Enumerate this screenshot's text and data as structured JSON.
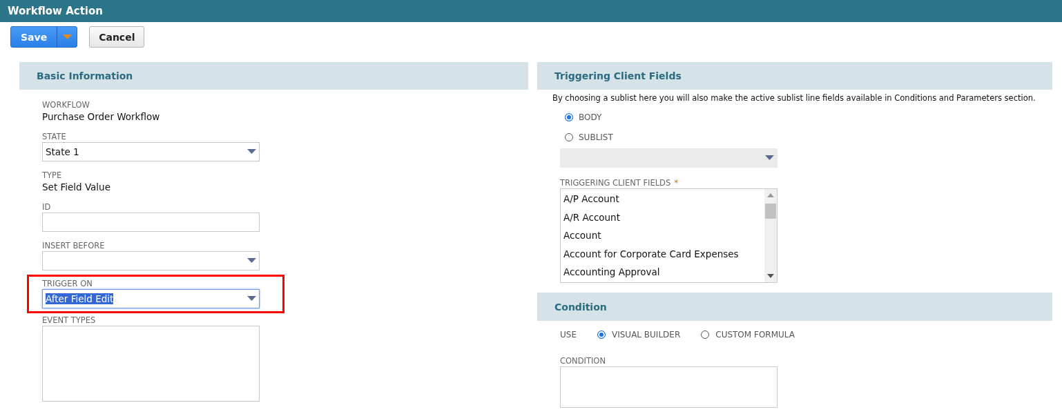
{
  "window": {
    "title": "Workflow Action"
  },
  "toolbar": {
    "save": "Save",
    "cancel": "Cancel"
  },
  "basic_information": {
    "title": "Basic Information",
    "fields": [
      {
        "kind": "text",
        "label": "WORKFLOW",
        "value": "Purchase Order Workflow"
      },
      {
        "kind": "select",
        "label": "STATE",
        "value": "State 1",
        "highlighted": false
      },
      {
        "kind": "text",
        "label": "TYPE",
        "value": "Set Field Value"
      },
      {
        "kind": "input",
        "label": "ID"
      },
      {
        "kind": "select",
        "label": "INSERT BEFORE",
        "highlighted": false
      },
      {
        "kind": "select",
        "label": "TRIGGER ON",
        "value": "After Field Edit",
        "highlighted": true
      },
      {
        "kind": "textarea",
        "label": "EVENT TYPES"
      }
    ]
  },
  "triggering_client_fields": {
    "title": "Triggering Client Fields",
    "note": "By choosing a sublist here you will also make the active sublist line fields available in Conditions and Parameters section.",
    "scope": [
      {
        "label": "BODY",
        "selected": true
      },
      {
        "label": "SUBLIST",
        "selected": false
      }
    ],
    "sublist_select": {
      "disabled": true
    },
    "fields_label": "TRIGGERING CLIENT FIELDS",
    "required_mark": "*",
    "items": [
      "A/P Account",
      "A/R Account",
      "Account",
      "Account for Corporate Card Expenses",
      "Accounting Approval"
    ]
  },
  "condition": {
    "title": "Condition",
    "use_label": "USE",
    "options": [
      {
        "label": "VISUAL BUILDER",
        "selected": true
      },
      {
        "label": "CUSTOM FORMULA",
        "selected": false
      }
    ],
    "condition_label": "CONDITION"
  }
}
